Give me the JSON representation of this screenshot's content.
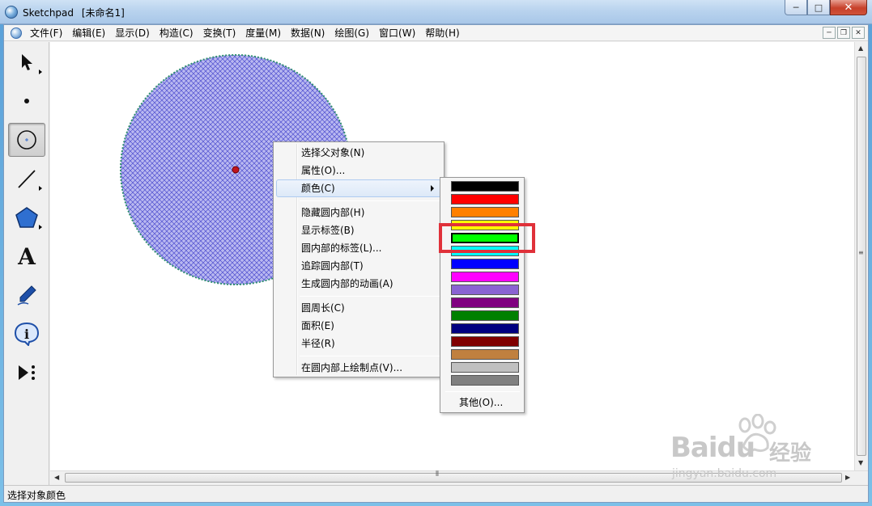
{
  "window": {
    "app_name": "Sketchpad",
    "document_title": "[未命名1]",
    "controls": {
      "minimize": "─",
      "maximize": "□",
      "close": "✕"
    }
  },
  "menubar": {
    "items": [
      "文件(F)",
      "编辑(E)",
      "显示(D)",
      "构造(C)",
      "变换(T)",
      "度量(M)",
      "数据(N)",
      "绘图(G)",
      "窗口(W)",
      "帮助(H)"
    ],
    "mdi_controls": {
      "minimize": "─",
      "restore": "❐",
      "close": "✕"
    }
  },
  "toolbox": {
    "tools": [
      {
        "name": "arrow-tool-icon",
        "has_submenu": true
      },
      {
        "name": "point-tool-icon",
        "has_submenu": false
      },
      {
        "name": "compass-tool-icon",
        "has_submenu": false,
        "active": true
      },
      {
        "name": "straightedge-tool-icon",
        "has_submenu": true
      },
      {
        "name": "polygon-tool-icon",
        "has_submenu": true
      },
      {
        "name": "text-tool-icon",
        "label": "A",
        "has_submenu": false
      },
      {
        "name": "marker-tool-icon",
        "has_submenu": false
      },
      {
        "name": "information-tool-icon",
        "label": "i",
        "has_submenu": false
      },
      {
        "name": "custom-tool-icon",
        "has_submenu": false
      }
    ]
  },
  "canvas": {
    "circle": {
      "fill_color": "#9d9be8",
      "hatch_color": "#4f4fd0",
      "outline_color": "#2f8f6f",
      "center_color": "#c0141e"
    }
  },
  "context_menu": {
    "items": [
      {
        "label": "选择父对象(N)"
      },
      {
        "label": "属性(O)..."
      },
      {
        "label": "颜色(C)",
        "submenu": true,
        "hover": true
      },
      {
        "separator": true
      },
      {
        "label": "隐藏圆内部(H)"
      },
      {
        "label": "显示标签(B)"
      },
      {
        "label": "圆内部的标签(L)..."
      },
      {
        "label": "追踪圆内部(T)"
      },
      {
        "label": "生成圆内部的动画(A)"
      },
      {
        "separator": true
      },
      {
        "label": "圆周长(C)"
      },
      {
        "label": "面积(E)"
      },
      {
        "label": "半径(R)"
      },
      {
        "separator": true
      },
      {
        "label": "在圆内部上绘制点(V)..."
      }
    ]
  },
  "color_menu": {
    "swatches": [
      "#000000",
      "#ff0000",
      "#ff8000",
      "#ffff00",
      "#00ff00",
      "#00ffff",
      "#0000ff",
      "#ff00ff",
      "#8a63d2",
      "#800080",
      "#008000",
      "#000080",
      "#800000",
      "#c0803f",
      "#c0c0c0",
      "#808080"
    ],
    "selected_index": 4,
    "other_label": "其他(O)...",
    "highlight_color": "#e0313a"
  },
  "statusbar": {
    "text": "选择对象颜色"
  },
  "watermark": {
    "brand": "Baidu",
    "brand_cn": "经验",
    "url": "jingyan.baidu.com"
  }
}
